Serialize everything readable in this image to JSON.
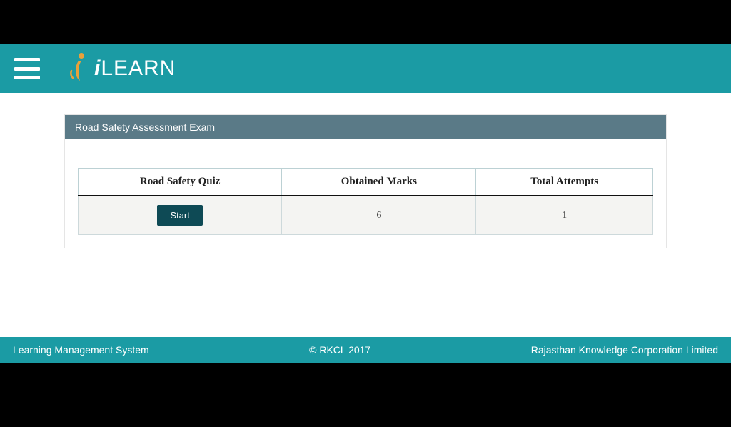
{
  "header": {
    "logo_text_prefix": "i",
    "logo_text": "LEARN"
  },
  "card": {
    "title": "Road Safety Assessment Exam"
  },
  "table": {
    "headers": {
      "col1": "Road Safety Quiz",
      "col2": "Obtained Marks",
      "col3": "Total Attempts"
    },
    "row": {
      "start_label": "Start",
      "obtained_marks": "6",
      "total_attempts": "1"
    }
  },
  "footer": {
    "left": "Learning Management System",
    "center": "© RKCL 2017",
    "right": "Rajasthan Knowledge Corporation Limited"
  }
}
